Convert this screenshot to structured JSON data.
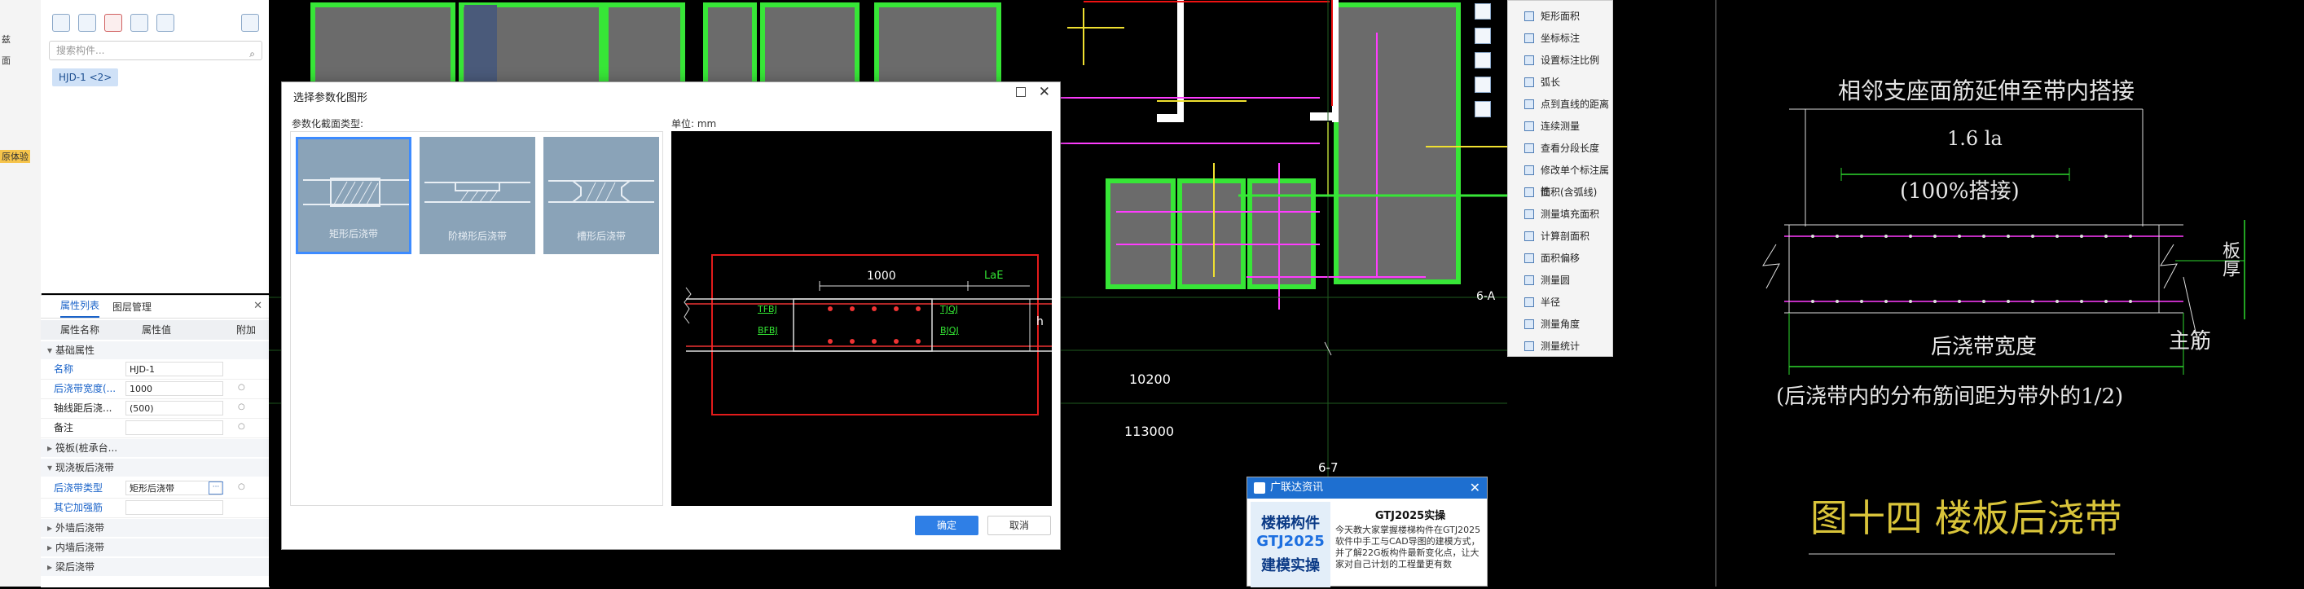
{
  "left_strip": {
    "items": [
      "兹",
      "面",
      "原体验"
    ]
  },
  "component_panel": {
    "search_placeholder": "搜索构件...",
    "selected_item": "HJD-1 <2>"
  },
  "property_panel": {
    "tabs": [
      "属性列表",
      "图层管理"
    ],
    "headers": [
      "属性名称",
      "属性值",
      "附加"
    ],
    "groups": {
      "basic": "基础属性",
      "raft": "筏板(桩承台...",
      "slab": "现浇板后浇带",
      "outer_wall": "外墙后浇带",
      "inner_wall": "内墙后浇带",
      "beam": "梁后浇带"
    },
    "rows": [
      {
        "key": "名称",
        "value": "HJD-1"
      },
      {
        "key": "后浇带宽度(...",
        "value": "1000"
      },
      {
        "key": "轴线距后浇...",
        "value": "(500)"
      },
      {
        "key": "备注",
        "value": ""
      },
      {
        "key": "后浇带类型",
        "value": "矩形后浇带"
      },
      {
        "key": "其它加强筋",
        "value": ""
      }
    ]
  },
  "cad_canvas": {
    "labels": [
      "10200",
      "113000",
      "6-7",
      "6-A"
    ]
  },
  "right_toolbar": {
    "items": [
      "矩形面积",
      "坐标标注",
      "设置标注比例",
      "弧长",
      "点到直线的距离",
      "连续测量",
      "查看分段长度",
      "修改单个标注属性",
      "面积(含弧线)",
      "测量填充面积",
      "计算剖面积",
      "面积偏移",
      "测量圆",
      "半径",
      "测量角度",
      "测量统计"
    ]
  },
  "dialog": {
    "title": "选择参数化图形",
    "type_label": "参数化截面类型:",
    "unit_label": "单位:  mm",
    "thumbnails": [
      "矩形后浇带",
      "阶梯形后浇带",
      "槽形后浇带"
    ],
    "preview": {
      "dimension": "1000",
      "lae": "LaE",
      "h": "h",
      "left_top": "TFBJ",
      "left_bottom": "BFBJ",
      "right_top": "TJQJ",
      "right_bottom": "BJQJ"
    },
    "ok_label": "确定",
    "cancel_label": "取消"
  },
  "news": {
    "header": "广联达资讯",
    "image_lines": [
      "楼梯构件",
      "GTJ2025",
      "建模实操"
    ],
    "title": "GTJ2025实操",
    "body": "今天教大家掌握楼梯构件在GTJ2025软件中手工与CAD导图的建模方式，并了解22G板构件最新变化点，让大家对自己计划的工程量更有数"
  },
  "detail": {
    "top_note": "相邻支座面筋延伸至带内搭接",
    "dim_1": "1.6 la",
    "dim_2": "(100%搭接)",
    "width_label": "后浇带宽度",
    "right_label_1": "板厚",
    "right_label_2": "主筋",
    "bottom_note": "(后浇带内的分布筋间距为带外的1/2)",
    "figure_title": "图十四  楼板后浇带"
  }
}
